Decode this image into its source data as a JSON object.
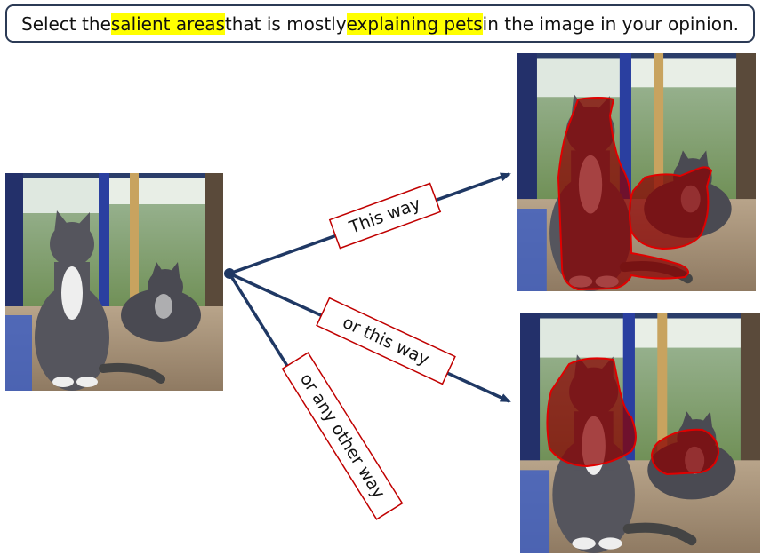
{
  "instruction": {
    "part1": "Select the ",
    "highlight1": "salient areas",
    "part2": " that is mostly ",
    "highlight2": "explaining pets",
    "part3": " in the image in your opinion."
  },
  "labels": {
    "this_way": "This way",
    "or_this_way": "or this way",
    "or_any_other_way": "or any other way"
  },
  "colors": {
    "arrow": "#1f3864",
    "label_border": "#c00000",
    "highlight": "#ffff00",
    "mask_fill": "#8b0000",
    "mask_stroke": "#e00000"
  },
  "images": {
    "source": "cats-on-table-photo",
    "result_top": "cats-segmentation-two-masks",
    "result_bottom": "cats-segmentation-alternate-masks"
  }
}
